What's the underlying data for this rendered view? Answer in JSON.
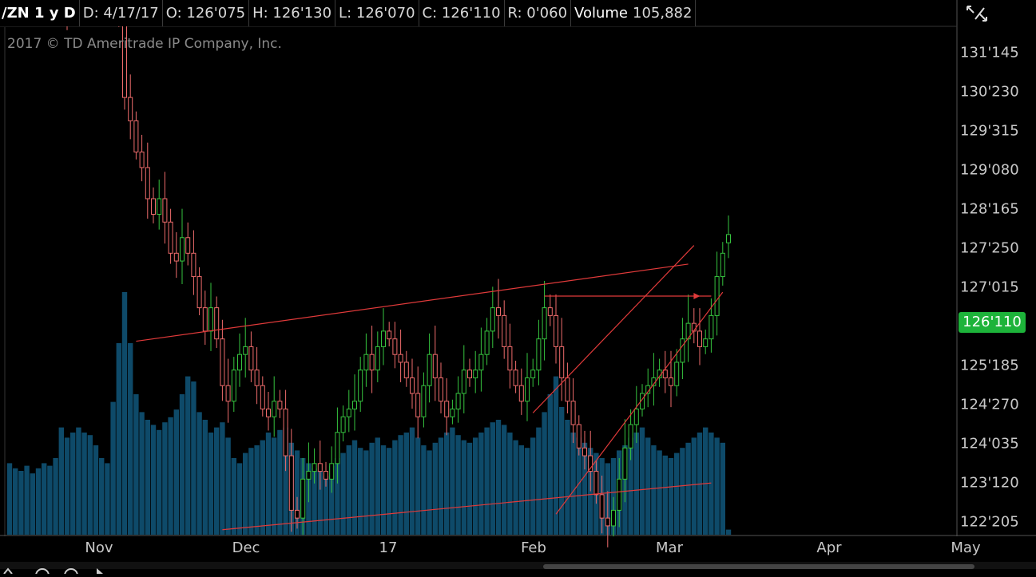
{
  "header": {
    "symbol": "/ZN 1 y D",
    "date": "D: 4/17/17",
    "open": "O: 126'075",
    "high": "H: 126'130",
    "low": "L: 126'070",
    "close": "C: 126'110",
    "range": "R: 0'060",
    "volume_label": "Volume",
    "volume_value": "105,882"
  },
  "copyright": "2017 © TD Ameritrade IP Company, Inc.",
  "colors": {
    "up": "#36c43f",
    "down": "#ef6c6c",
    "volume": "#0e4a69",
    "trendline": "#e03a3a",
    "last_price_box": "#1db33a",
    "grid": "#2a2a2a"
  },
  "icons": {
    "toggle": "collapse-arrows-icon"
  },
  "price_axis": {
    "ticks": [
      "131'145",
      "130'230",
      "129'315",
      "129'080",
      "128'165",
      "127'250",
      "127'015",
      "125'185",
      "124'270",
      "124'035",
      "123'120",
      "122'205"
    ],
    "last_price": "126'110"
  },
  "date_axis": {
    "labels": [
      "Nov",
      "Dec",
      "17",
      "Feb",
      "Mar",
      "Apr",
      "May"
    ]
  },
  "chart_data": {
    "type": "candlestick",
    "y_axis_format": "32nds (handle'32nds with half-ticks)",
    "y_ticks": [
      "131'145",
      "130'230",
      "129'315",
      "129'080",
      "128'165",
      "127'250",
      "127'015",
      "126'110",
      "125'185",
      "124'270",
      "124'035",
      "123'120",
      "122'205"
    ],
    "x_ticks": [
      "Nov",
      "Dec",
      "17",
      "Feb",
      "Mar",
      "Apr",
      "May"
    ],
    "last_bar": {
      "date": "4/17/17",
      "open": 126.234,
      "high": 126.406,
      "low": 126.219,
      "close": 126.344,
      "volume": 105882
    },
    "closes": [
      129.7,
      129.9,
      130.0,
      130.0,
      129.9,
      130.0,
      130.0,
      129.9,
      129.8,
      129.5,
      129.2,
      129.3,
      129.4,
      129.5,
      129.7,
      129.8,
      129.9,
      130.1,
      129.5,
      129.3,
      128.1,
      127.8,
      127.4,
      127.2,
      126.8,
      126.6,
      126.8,
      126.5,
      126.1,
      126.0,
      126.3,
      126.1,
      125.8,
      125.4,
      125.1,
      125.4,
      125.0,
      124.4,
      124.2,
      124.6,
      124.8,
      124.9,
      124.6,
      124.4,
      124.1,
      124.0,
      124.2,
      124.1,
      123.5,
      122.8,
      122.7,
      123.2,
      123.3,
      123.4,
      123.3,
      123.2,
      123.4,
      123.8,
      124.0,
      124.1,
      124.2,
      124.6,
      124.8,
      124.6,
      124.9,
      125.1,
      125.0,
      124.8,
      124.7,
      124.5,
      124.3,
      124.0,
      124.4,
      124.8,
      124.5,
      124.2,
      124.0,
      124.1,
      124.3,
      124.6,
      124.5,
      124.6,
      124.8,
      125.1,
      125.4,
      125.3,
      124.9,
      124.6,
      124.4,
      124.2,
      124.5,
      124.6,
      125.0,
      125.4,
      125.3,
      124.9,
      124.5,
      124.2,
      123.9,
      123.6,
      123.5,
      123.3,
      123.0,
      122.7,
      122.6,
      122.8,
      123.2,
      123.6,
      123.9,
      124.1,
      124.3,
      124.4,
      124.5,
      124.6,
      124.5,
      124.4,
      124.7,
      125.0,
      125.2,
      125.1,
      124.9,
      125.0,
      125.3,
      125.8,
      126.1,
      126.34
    ],
    "volumes": [
      0.28,
      0.26,
      0.25,
      0.27,
      0.24,
      0.26,
      0.28,
      0.27,
      0.3,
      0.42,
      0.38,
      0.4,
      0.42,
      0.4,
      0.39,
      0.35,
      0.3,
      0.28,
      0.52,
      0.75,
      0.95,
      0.75,
      0.55,
      0.48,
      0.45,
      0.43,
      0.41,
      0.44,
      0.46,
      0.49,
      0.55,
      0.62,
      0.6,
      0.48,
      0.45,
      0.4,
      0.42,
      0.44,
      0.38,
      0.3,
      0.28,
      0.32,
      0.34,
      0.35,
      0.37,
      0.4,
      0.38,
      0.41,
      0.42,
      0.36,
      0.33,
      0.3,
      0.28,
      0.26,
      0.25,
      0.23,
      0.27,
      0.3,
      0.32,
      0.35,
      0.37,
      0.34,
      0.33,
      0.36,
      0.38,
      0.35,
      0.34,
      0.37,
      0.39,
      0.4,
      0.42,
      0.38,
      0.35,
      0.33,
      0.36,
      0.38,
      0.4,
      0.42,
      0.39,
      0.37,
      0.36,
      0.38,
      0.4,
      0.42,
      0.44,
      0.45,
      0.43,
      0.4,
      0.37,
      0.35,
      0.34,
      0.38,
      0.42,
      0.48,
      0.55,
      0.62,
      0.5,
      0.45,
      0.4,
      0.38,
      0.36,
      0.34,
      0.32,
      0.3,
      0.28,
      0.3,
      0.33,
      0.35,
      0.38,
      0.4,
      0.42,
      0.38,
      0.35,
      0.33,
      0.31,
      0.3,
      0.32,
      0.34,
      0.36,
      0.38,
      0.4,
      0.42,
      0.4,
      0.38,
      0.36,
      0.02
    ],
    "trendlines": [
      {
        "name": "upper-channel",
        "from": [
          22,
          124.97
        ],
        "to": [
          118,
          125.96
        ]
      },
      {
        "name": "lower-channel",
        "from": [
          37,
          122.55
        ],
        "to": [
          122,
          123.15
        ]
      },
      {
        "name": "horizontal-resistance",
        "from": [
          93,
          125.55
        ],
        "to": [
          122,
          125.55
        ]
      },
      {
        "name": "rising-channel-top",
        "from": [
          91,
          124.05
        ],
        "to": [
          119,
          126.2
        ]
      },
      {
        "name": "rising-channel-bottom",
        "from": [
          95,
          122.75
        ],
        "to": [
          124,
          125.6
        ]
      }
    ]
  }
}
